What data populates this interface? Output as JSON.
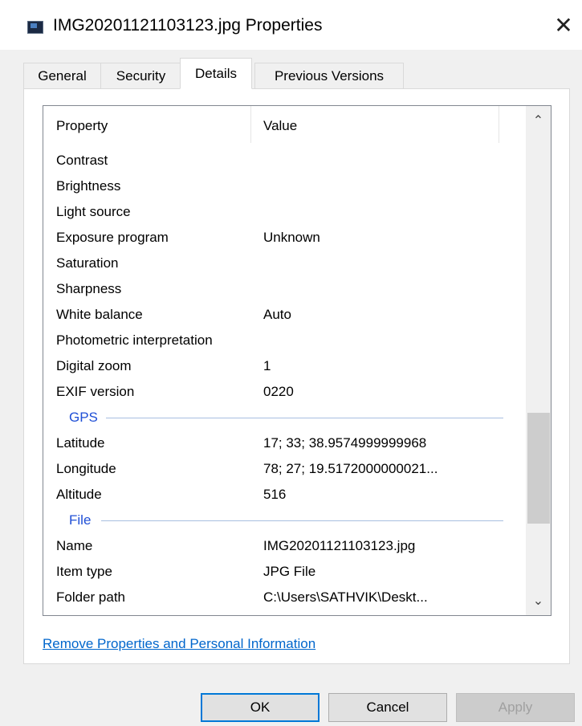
{
  "window": {
    "title": "IMG20201121103123.jpg Properties",
    "close_glyph": "✕",
    "icon": "image-file-icon"
  },
  "tabs": [
    {
      "label": "General",
      "active": false
    },
    {
      "label": "Security",
      "active": false
    },
    {
      "label": "Details",
      "active": true
    },
    {
      "label": "Previous Versions",
      "active": false
    }
  ],
  "details": {
    "columns": {
      "property": "Property",
      "value": "Value"
    },
    "rows_top": [
      {
        "property": "Contrast",
        "value": ""
      },
      {
        "property": "Brightness",
        "value": ""
      },
      {
        "property": "Light source",
        "value": ""
      },
      {
        "property": "Exposure program",
        "value": "Unknown"
      },
      {
        "property": "Saturation",
        "value": ""
      },
      {
        "property": "Sharpness",
        "value": ""
      },
      {
        "property": "White balance",
        "value": "Auto"
      },
      {
        "property": "Photometric interpretation",
        "value": ""
      },
      {
        "property": "Digital zoom",
        "value": "1"
      },
      {
        "property": "EXIF version",
        "value": "0220"
      }
    ],
    "group_gps": "GPS",
    "rows_gps": [
      {
        "property": "Latitude",
        "value": "17; 33; 38.9574999999968"
      },
      {
        "property": "Longitude",
        "value": "78; 27; 19.5172000000021..."
      },
      {
        "property": "Altitude",
        "value": "516"
      }
    ],
    "group_file": "File",
    "rows_file": [
      {
        "property": "Name",
        "value": "IMG20201121103123.jpg"
      },
      {
        "property": "Item type",
        "value": "JPG File"
      },
      {
        "property": "Folder path",
        "value": "C:\\Users\\SATHVIK\\Deskt..."
      }
    ],
    "scroll_up_glyph": "⌃",
    "scroll_down_glyph": "⌄"
  },
  "remove_link": "Remove Properties and Personal Information",
  "buttons": {
    "ok": "OK",
    "cancel": "Cancel",
    "apply": "Apply"
  },
  "colors": {
    "accent": "#0078d7",
    "group_header": "#1f4fd6",
    "link": "#0066cc"
  }
}
